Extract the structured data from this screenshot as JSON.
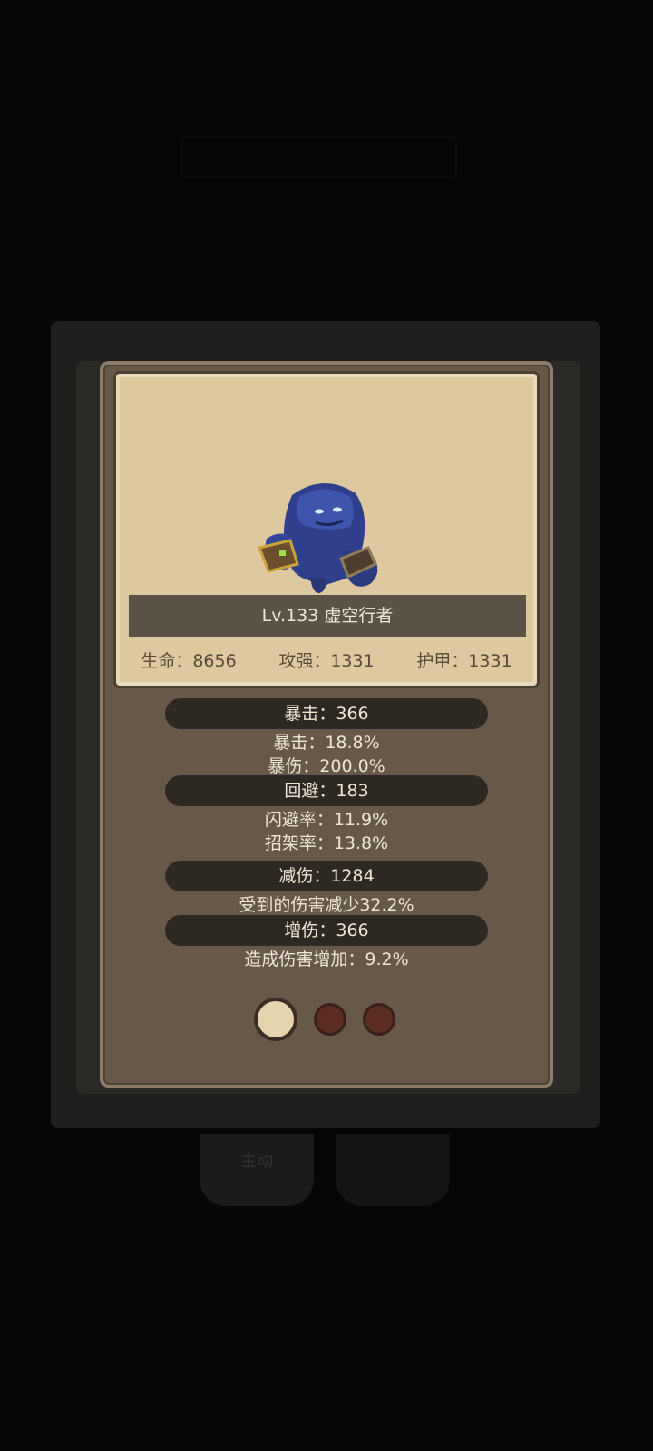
{
  "background": {
    "tab_left_label": "主动",
    "tab_right_label": "..."
  },
  "monster": {
    "level_name": "Lv.133 虚空行者",
    "base_stats": [
      "生命：8656",
      "攻强：1331",
      "护甲：1331"
    ]
  },
  "sections": {
    "crit": {
      "header": "暴击：366",
      "lines": [
        "暴击：18.8%",
        "暴伤：200.0%"
      ]
    },
    "dodge": {
      "header": "回避：183",
      "lines": [
        "闪避率：11.9%",
        "招架率：13.8%"
      ]
    },
    "reduction": {
      "header": "减伤：1284",
      "lines": [
        "受到的伤害减少32.2%"
      ]
    },
    "increase": {
      "header": "增伤：366",
      "lines": [
        "造成伤害增加：9.2%"
      ]
    }
  },
  "pager": {
    "current": 1,
    "total": 3
  },
  "colors": {
    "card_bg": "#675848",
    "parchment": "#ddc8a0",
    "header_bar": "#2e2823",
    "active_dot": "#e4d3ad",
    "inactive_dot": "#5a2c22",
    "monster_blue": "#3b4f9c"
  }
}
